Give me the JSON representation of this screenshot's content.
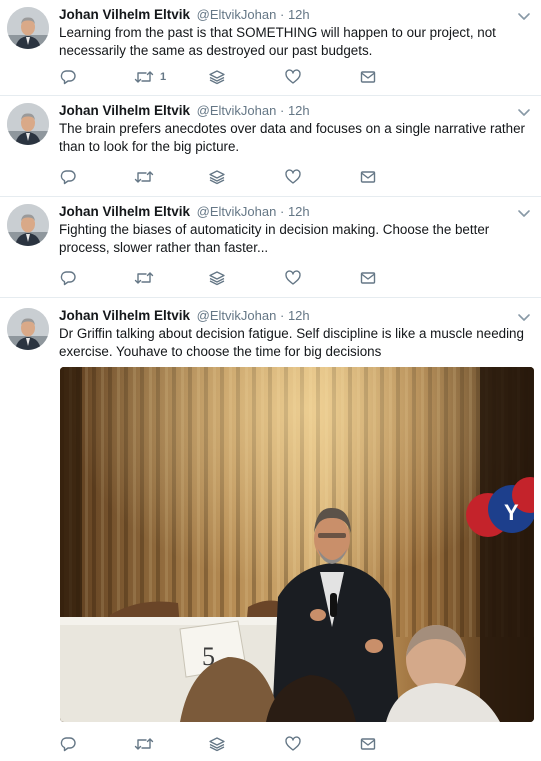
{
  "tweets": [
    {
      "author_name": "Johan Vilhelm Eltvik",
      "handle": "@EltvikJohan",
      "separator": "·",
      "time": "12h",
      "text": "Learning from the past is that SOMETHING will happen to our project, not necessarily the same as destroyed our past budgets.",
      "retweet_count": "1"
    },
    {
      "author_name": "Johan Vilhelm Eltvik",
      "handle": "@EltvikJohan",
      "separator": "·",
      "time": "12h",
      "text": "The brain prefers anecdotes over data and focuses on a single narrative rather than to look for the big picture."
    },
    {
      "author_name": "Johan Vilhelm Eltvik",
      "handle": "@EltvikJohan",
      "separator": "·",
      "time": "12h",
      "text": "Fighting the biases of automaticity in decision making. Choose the better process, slower rather than faster..."
    },
    {
      "author_name": "Johan Vilhelm Eltvik",
      "handle": "@EltvikJohan",
      "separator": "·",
      "time": "12h",
      "text": "Dr Griffin talking about decision fatigue. Self discipline is like a muscle needing exercise. Youhave to choose the time for big decisions",
      "photo_sign_text": "5",
      "balloon_text": "Y"
    }
  ],
  "icons": {
    "reply": "reply-icon",
    "retweet": "retweet-icon",
    "stack": "stack-icon",
    "like": "heart-icon",
    "dm": "envelope-icon",
    "caret": "chevron-down-icon"
  },
  "colors": {
    "text": "#14171a",
    "muted": "#657786",
    "divider": "#e6ecf0"
  }
}
